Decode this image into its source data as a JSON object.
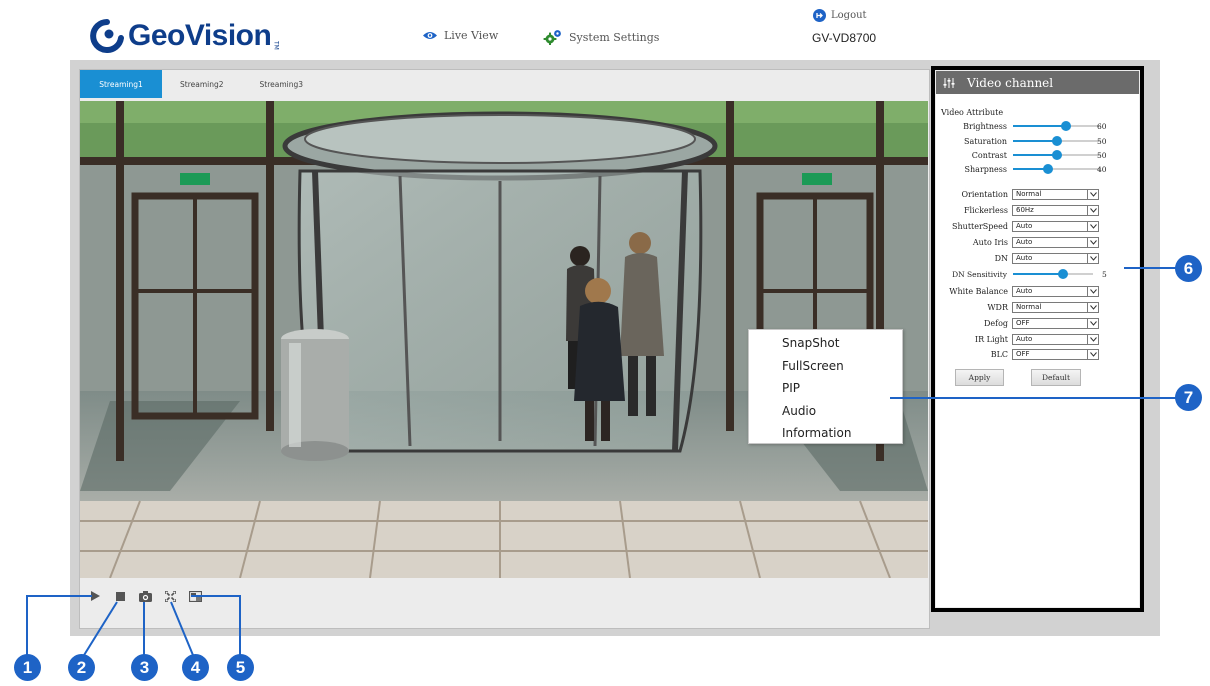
{
  "header": {
    "brand": "GeoVision",
    "brand_tm": "TM",
    "nav": [
      {
        "label": "Live View",
        "icon": "eye-icon"
      },
      {
        "label": "System Settings",
        "icon": "gears-icon"
      }
    ],
    "logout_label": "Logout",
    "device_name": "GV-VD8700"
  },
  "tabs": [
    {
      "label": "Streaming1",
      "active": true
    },
    {
      "label": "Streaming2",
      "active": false
    },
    {
      "label": "Streaming3",
      "active": false
    }
  ],
  "player_controls": [
    {
      "name": "play-icon"
    },
    {
      "name": "stop-icon"
    },
    {
      "name": "camera-snapshot-icon"
    },
    {
      "name": "fullscreen-icon"
    },
    {
      "name": "pip-icon"
    }
  ],
  "context_menu": [
    "SnapShot",
    "FullScreen",
    "PIP",
    "Audio",
    "Information"
  ],
  "panel": {
    "title": "Video channel",
    "section_title": "Video Attribute",
    "sliders": [
      {
        "label": "Brightness",
        "value": 60
      },
      {
        "label": "Saturation",
        "value": 50
      },
      {
        "label": "Contrast",
        "value": 50
      },
      {
        "label": "Sharpness",
        "value": 40
      }
    ],
    "selects": [
      {
        "label": "Orientation",
        "value": "Normal"
      },
      {
        "label": "Flickerless",
        "value": "60Hz"
      },
      {
        "label": "ShutterSpeed",
        "value": "Auto"
      },
      {
        "label": "Auto Iris",
        "value": "Auto"
      },
      {
        "label": "DN",
        "value": "Auto"
      }
    ],
    "dn_sensitivity": {
      "label": "DN Sensitivity",
      "value": 5
    },
    "selects2": [
      {
        "label": "White Balance",
        "value": "Auto"
      },
      {
        "label": "WDR",
        "value": "Normal"
      },
      {
        "label": "Defog",
        "value": "OFF"
      },
      {
        "label": "IR Light",
        "value": "Auto"
      },
      {
        "label": "BLC",
        "value": "OFF"
      }
    ],
    "apply_label": "Apply",
    "default_label": "Default"
  },
  "callouts": [
    "1",
    "2",
    "3",
    "4",
    "5",
    "6",
    "7"
  ],
  "colors": {
    "accent": "#1a8fd3",
    "callout": "#1e63c6",
    "brand": "#0e3d8a"
  }
}
